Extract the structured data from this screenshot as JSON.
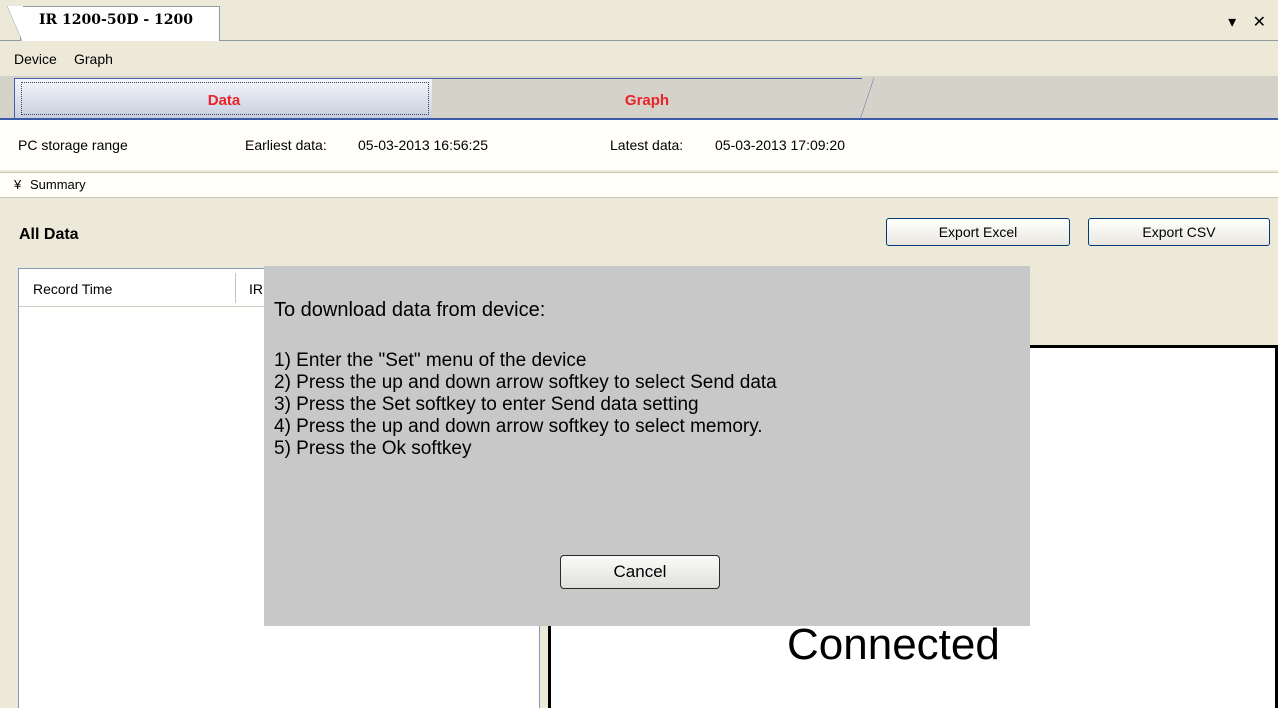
{
  "window": {
    "doc_tab_title": "IR 1200-50D - 1200",
    "controls": "▾ ✕"
  },
  "menu": {
    "items": [
      "Device",
      "Graph"
    ]
  },
  "view_tabs": {
    "data_label": "Data",
    "graph_label": "Graph",
    "active": "Data",
    "accent_color": "#e8232a"
  },
  "range": {
    "label": "PC storage range",
    "earliest_label": "Earliest data:",
    "earliest_value": "05-03-2013 16:56:25",
    "latest_label": "Latest data:",
    "latest_value": "05-03-2013 17:09:20"
  },
  "summary": {
    "icon": "double-chevron-down-icon",
    "label": "Summary"
  },
  "all_data": {
    "title": "All Data",
    "export_excel": "Export Excel",
    "export_csv": "Export CSV",
    "columns": [
      "Record Time",
      "IR"
    ]
  },
  "status": {
    "text": "Connected"
  },
  "dialog": {
    "title": "To download data from device:",
    "steps": [
      "1) Enter the \"Set\" menu of the device",
      "2) Press the up and down arrow softkey to select Send data",
      "3) Press the Set softkey to enter Send data setting",
      "4) Press the up and down arrow softkey to select memory.",
      "5) Press the Ok softkey"
    ],
    "cancel_label": "Cancel"
  }
}
